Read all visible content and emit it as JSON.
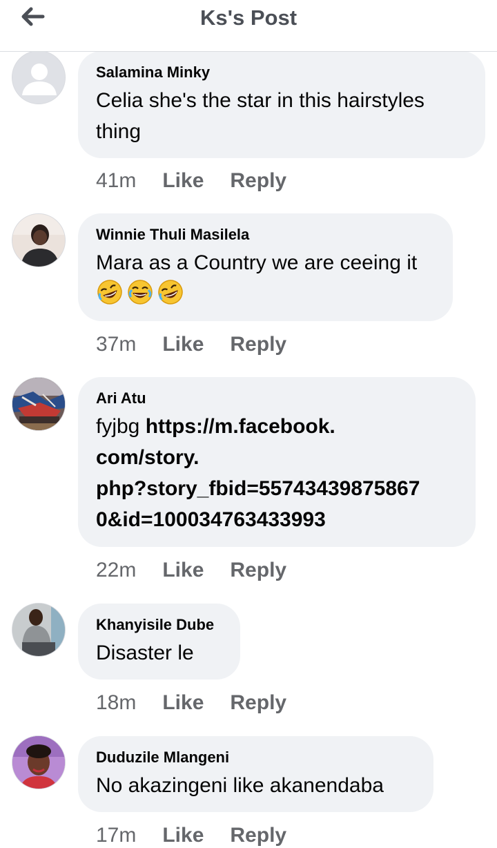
{
  "header": {
    "title": "Ks's Post",
    "back_icon": "arrow-left-icon"
  },
  "colors": {
    "bubble": "#f0f2f5",
    "meta_text": "#65676b",
    "title_text": "#4b4f56"
  },
  "comments": [
    {
      "author": "Salamina Minky",
      "text": "Celia she's the star in this hairstyles thing",
      "time": "41m",
      "like": "Like",
      "reply": "Reply",
      "avatar": "default-avatar-icon"
    },
    {
      "author": "Winnie Thuli Masilela",
      "text": "Mara as a Country we are ceeing it",
      "emojis": [
        "rolling-laughing-emoji",
        "tears-of-joy-emoji",
        "rolling-laughing-emoji"
      ],
      "time": "37m",
      "like": "Like",
      "reply": "Reply",
      "avatar": "user-photo"
    },
    {
      "author": "Ari Atu",
      "text_prefix": "fyjbg ",
      "link_line1": "https://m.facebook.",
      "link_line2": "com/story.",
      "link_line3": "php?story_fbid=55743439875867",
      "link_line4": "0&id=100034763433993",
      "time": "22m",
      "like": "Like",
      "reply": "Reply",
      "avatar": "user-photo"
    },
    {
      "author": "Khanyisile Dube",
      "text": "Disaster le",
      "time": "18m",
      "like": "Like",
      "reply": "Reply",
      "avatar": "user-photo"
    },
    {
      "author": "Duduzile Mlangeni",
      "text": "No akazingeni like akanendaba",
      "time": "17m",
      "like": "Like",
      "reply": "Reply",
      "avatar": "user-photo"
    }
  ]
}
